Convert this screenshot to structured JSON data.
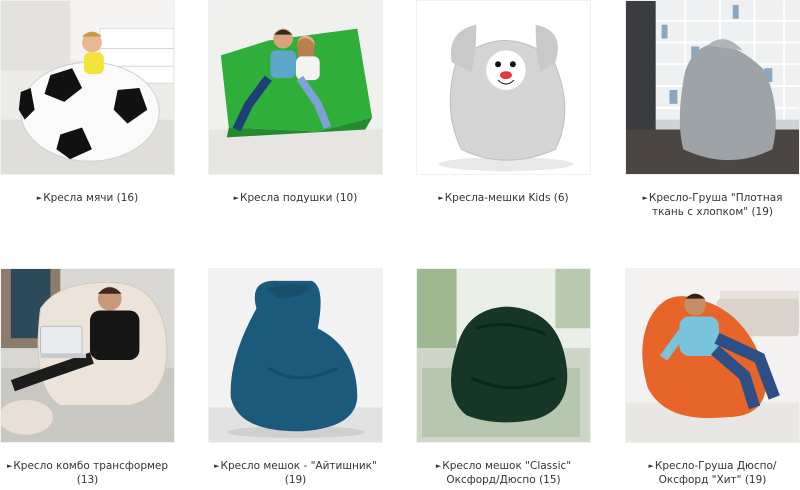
{
  "categories": [
    {
      "label": "Кресла мячи",
      "count": "(16)",
      "image": "soccer-ball-beanbag"
    },
    {
      "label": "Кресла подушки",
      "count": "(10)",
      "image": "green-pillow-beanbag"
    },
    {
      "label": "Кресла-мешки Kids",
      "count": "(6)",
      "image": "bunny-kids-beanbag"
    },
    {
      "label": "Кресло-Груша \"Плотная ткань с хлопком\"",
      "count": "(19)",
      "image": "grey-pear-beanbag"
    },
    {
      "label": "Кресло комбо трансформер",
      "count": "(13)",
      "image": "combo-transformer-beanbag"
    },
    {
      "label": "Кресло мешок - \"Айтишник\"",
      "count": "(19)",
      "image": "blue-it-beanbag"
    },
    {
      "label": "Кресло мешок \"Classic\" Оксфорд/Дюспо",
      "count": "(15)",
      "image": "dark-green-classic-beanbag"
    },
    {
      "label": "Кресло-Груша Дюспо/Оксфорд \"Хит\"",
      "count": "(19)",
      "image": "orange-hit-beanbag"
    }
  ],
  "arrow_glyph": "►"
}
